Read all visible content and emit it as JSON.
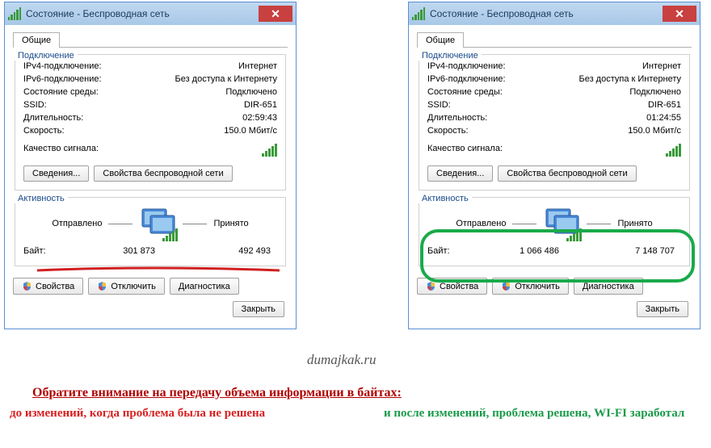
{
  "title": "Состояние - Беспроводная сеть",
  "tab_general": "Общие",
  "group_connection": "Подключение",
  "group_activity": "Активность",
  "labels": {
    "ipv4": "IPv4-подключение:",
    "ipv6": "IPv6-подключение:",
    "media": "Состояние среды:",
    "ssid": "SSID:",
    "duration": "Длительность:",
    "speed": "Скорость:",
    "signal": "Качество сигнала:",
    "sent": "Отправлено",
    "received": "Принято",
    "bytes": "Байт:"
  },
  "buttons": {
    "details": "Сведения...",
    "wireless_props": "Свойства беспроводной сети",
    "props": "Свойства",
    "disable": "Отключить",
    "diagnose": "Диагностика",
    "close": "Закрыть"
  },
  "left": {
    "ipv4": "Интернет",
    "ipv6": "Без доступа к Интернету",
    "media": "Подключено",
    "ssid": "DIR-651",
    "duration": "02:59:43",
    "speed": "150.0 Мбит/с",
    "sent": "301 873",
    "received": "492 493"
  },
  "right": {
    "ipv4": "Интернет",
    "ipv6": "Без доступа к Интернету",
    "media": "Подключено",
    "ssid": "DIR-651",
    "duration": "01:24:55",
    "speed": "150.0 Мбит/с",
    "sent": "1 066 486",
    "received": "7 148 707"
  },
  "captions": {
    "main": "Обратите внимание на передачу объема информации в байтах:",
    "before": "до изменений, когда проблема была не решена",
    "after": "и после изменений, проблема решена, WI-FI заработал"
  },
  "watermark": "dumajkak.ru"
}
